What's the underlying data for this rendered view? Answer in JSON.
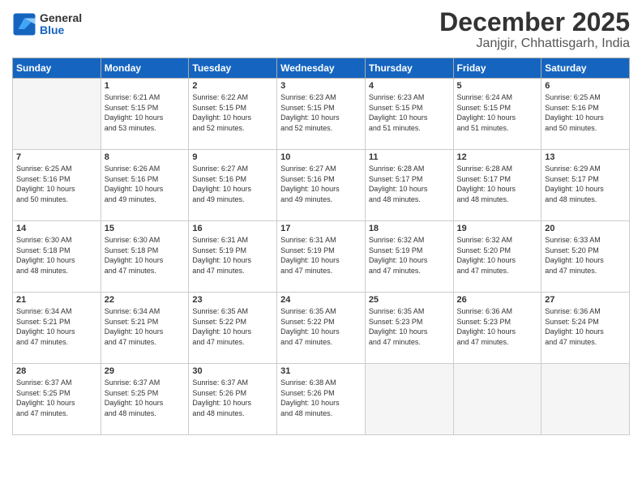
{
  "header": {
    "logo_general": "General",
    "logo_blue": "Blue",
    "month_title": "December 2025",
    "location": "Janjgir, Chhattisgarh, India"
  },
  "weekdays": [
    "Sunday",
    "Monday",
    "Tuesday",
    "Wednesday",
    "Thursday",
    "Friday",
    "Saturday"
  ],
  "weeks": [
    [
      {
        "day": "",
        "info": ""
      },
      {
        "day": "1",
        "info": "Sunrise: 6:21 AM\nSunset: 5:15 PM\nDaylight: 10 hours\nand 53 minutes."
      },
      {
        "day": "2",
        "info": "Sunrise: 6:22 AM\nSunset: 5:15 PM\nDaylight: 10 hours\nand 52 minutes."
      },
      {
        "day": "3",
        "info": "Sunrise: 6:23 AM\nSunset: 5:15 PM\nDaylight: 10 hours\nand 52 minutes."
      },
      {
        "day": "4",
        "info": "Sunrise: 6:23 AM\nSunset: 5:15 PM\nDaylight: 10 hours\nand 51 minutes."
      },
      {
        "day": "5",
        "info": "Sunrise: 6:24 AM\nSunset: 5:15 PM\nDaylight: 10 hours\nand 51 minutes."
      },
      {
        "day": "6",
        "info": "Sunrise: 6:25 AM\nSunset: 5:16 PM\nDaylight: 10 hours\nand 50 minutes."
      }
    ],
    [
      {
        "day": "7",
        "info": "Sunrise: 6:25 AM\nSunset: 5:16 PM\nDaylight: 10 hours\nand 50 minutes."
      },
      {
        "day": "8",
        "info": "Sunrise: 6:26 AM\nSunset: 5:16 PM\nDaylight: 10 hours\nand 49 minutes."
      },
      {
        "day": "9",
        "info": "Sunrise: 6:27 AM\nSunset: 5:16 PM\nDaylight: 10 hours\nand 49 minutes."
      },
      {
        "day": "10",
        "info": "Sunrise: 6:27 AM\nSunset: 5:16 PM\nDaylight: 10 hours\nand 49 minutes."
      },
      {
        "day": "11",
        "info": "Sunrise: 6:28 AM\nSunset: 5:17 PM\nDaylight: 10 hours\nand 48 minutes."
      },
      {
        "day": "12",
        "info": "Sunrise: 6:28 AM\nSunset: 5:17 PM\nDaylight: 10 hours\nand 48 minutes."
      },
      {
        "day": "13",
        "info": "Sunrise: 6:29 AM\nSunset: 5:17 PM\nDaylight: 10 hours\nand 48 minutes."
      }
    ],
    [
      {
        "day": "14",
        "info": "Sunrise: 6:30 AM\nSunset: 5:18 PM\nDaylight: 10 hours\nand 48 minutes."
      },
      {
        "day": "15",
        "info": "Sunrise: 6:30 AM\nSunset: 5:18 PM\nDaylight: 10 hours\nand 47 minutes."
      },
      {
        "day": "16",
        "info": "Sunrise: 6:31 AM\nSunset: 5:19 PM\nDaylight: 10 hours\nand 47 minutes."
      },
      {
        "day": "17",
        "info": "Sunrise: 6:31 AM\nSunset: 5:19 PM\nDaylight: 10 hours\nand 47 minutes."
      },
      {
        "day": "18",
        "info": "Sunrise: 6:32 AM\nSunset: 5:19 PM\nDaylight: 10 hours\nand 47 minutes."
      },
      {
        "day": "19",
        "info": "Sunrise: 6:32 AM\nSunset: 5:20 PM\nDaylight: 10 hours\nand 47 minutes."
      },
      {
        "day": "20",
        "info": "Sunrise: 6:33 AM\nSunset: 5:20 PM\nDaylight: 10 hours\nand 47 minutes."
      }
    ],
    [
      {
        "day": "21",
        "info": "Sunrise: 6:34 AM\nSunset: 5:21 PM\nDaylight: 10 hours\nand 47 minutes."
      },
      {
        "day": "22",
        "info": "Sunrise: 6:34 AM\nSunset: 5:21 PM\nDaylight: 10 hours\nand 47 minutes."
      },
      {
        "day": "23",
        "info": "Sunrise: 6:35 AM\nSunset: 5:22 PM\nDaylight: 10 hours\nand 47 minutes."
      },
      {
        "day": "24",
        "info": "Sunrise: 6:35 AM\nSunset: 5:22 PM\nDaylight: 10 hours\nand 47 minutes."
      },
      {
        "day": "25",
        "info": "Sunrise: 6:35 AM\nSunset: 5:23 PM\nDaylight: 10 hours\nand 47 minutes."
      },
      {
        "day": "26",
        "info": "Sunrise: 6:36 AM\nSunset: 5:23 PM\nDaylight: 10 hours\nand 47 minutes."
      },
      {
        "day": "27",
        "info": "Sunrise: 6:36 AM\nSunset: 5:24 PM\nDaylight: 10 hours\nand 47 minutes."
      }
    ],
    [
      {
        "day": "28",
        "info": "Sunrise: 6:37 AM\nSunset: 5:25 PM\nDaylight: 10 hours\nand 47 minutes."
      },
      {
        "day": "29",
        "info": "Sunrise: 6:37 AM\nSunset: 5:25 PM\nDaylight: 10 hours\nand 48 minutes."
      },
      {
        "day": "30",
        "info": "Sunrise: 6:37 AM\nSunset: 5:26 PM\nDaylight: 10 hours\nand 48 minutes."
      },
      {
        "day": "31",
        "info": "Sunrise: 6:38 AM\nSunset: 5:26 PM\nDaylight: 10 hours\nand 48 minutes."
      },
      {
        "day": "",
        "info": ""
      },
      {
        "day": "",
        "info": ""
      },
      {
        "day": "",
        "info": ""
      }
    ]
  ]
}
